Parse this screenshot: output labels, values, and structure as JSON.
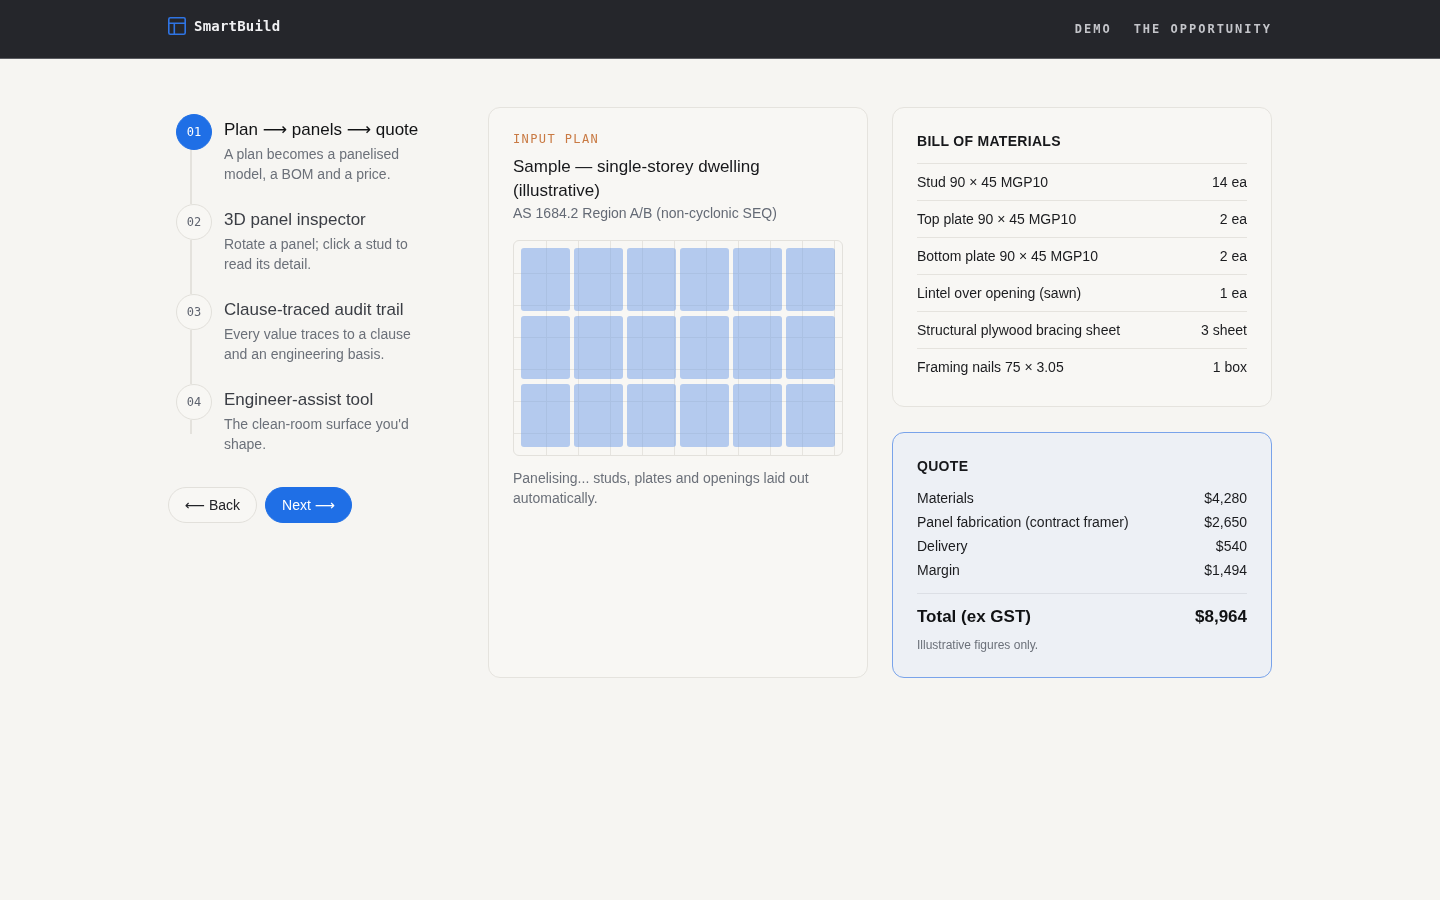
{
  "header": {
    "brand": "SmartBuild",
    "nav": [
      "DEMO",
      "THE OPPORTUNITY"
    ]
  },
  "steps": [
    {
      "number": "01",
      "title": "Plan ⟶ panels ⟶ quote",
      "description": "A plan becomes a panelised model, a BOM and a price.",
      "selected": true
    },
    {
      "number": "02",
      "title": "3D panel inspector",
      "description": "Rotate a panel; click a stud to read its detail.",
      "selected": false
    },
    {
      "number": "03",
      "title": "Clause-traced audit trail",
      "description": "Every value traces to a clause and an engineering basis.",
      "selected": false
    },
    {
      "number": "04",
      "title": "Engineer-assist tool",
      "description": "The clean-room surface you'd shape.",
      "selected": false
    }
  ],
  "buttons": [
    {
      "label": "⟵ Back",
      "kind": "secondary"
    },
    {
      "label": "Next ⟶",
      "kind": "primary"
    }
  ],
  "input_plan": {
    "eyebrow": "INPUT PLAN",
    "title": "Sample — single-storey dwelling (illustrative)",
    "subtitle": "AS 1684.2 Region A/B (non-cyclonic SEQ)",
    "caption": "Panelising... studs, plates and openings laid out automatically."
  },
  "bill_of_materials": {
    "title": "BILL OF MATERIALS",
    "rows": [
      {
        "item": "Stud 90 × 45 MGP10",
        "quantity": "14 ea"
      },
      {
        "item": "Top plate 90 × 45 MGP10",
        "quantity": "2 ea"
      },
      {
        "item": "Bottom plate 90 × 45 MGP10",
        "quantity": "2 ea"
      },
      {
        "item": "Lintel over opening (sawn)",
        "quantity": "1 ea"
      },
      {
        "item": "Structural plywood bracing sheet",
        "quantity": "3 sheet"
      },
      {
        "item": "Framing nails 75 × 3.05",
        "quantity": "1 box"
      }
    ]
  },
  "quote": {
    "title": "QUOTE",
    "lines": [
      {
        "label": "Materials",
        "amount": "$4,280"
      },
      {
        "label": "Panel fabrication (contract framer)",
        "amount": "$2,650"
      },
      {
        "label": "Delivery",
        "amount": "$540"
      },
      {
        "label": "Margin",
        "amount": "$1,494"
      }
    ],
    "total": {
      "label": "Total (ex GST)",
      "amount": "$8,964"
    },
    "note": "Illustrative figures only."
  }
}
